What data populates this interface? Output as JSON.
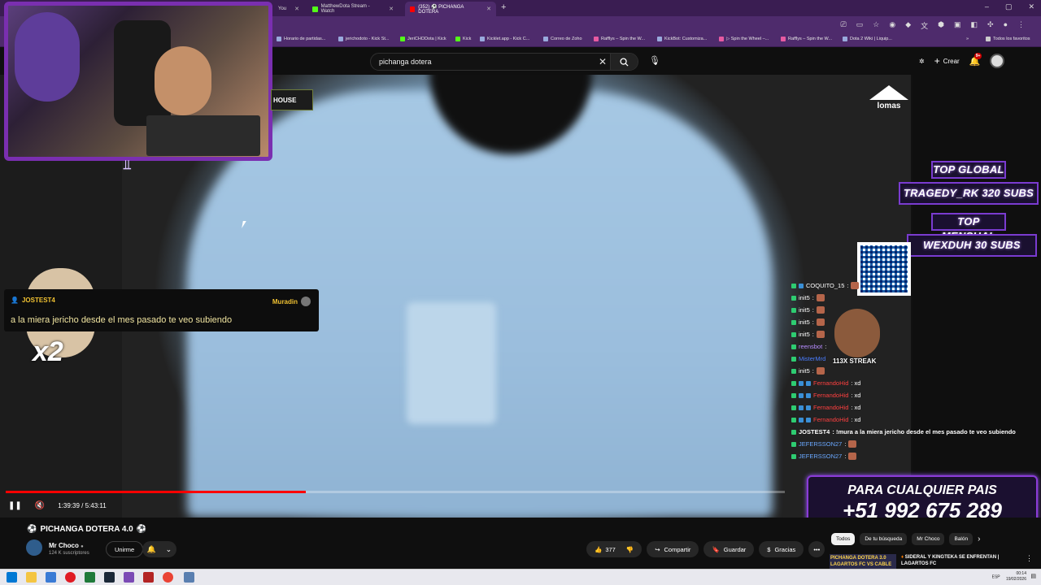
{
  "browser": {
    "tabs": [
      {
        "label": "You",
        "active": false
      },
      {
        "label": "MatthewDota Stream - Watch",
        "active": false
      },
      {
        "label": "(352) ⚽ PICHANGA DOTERA",
        "active": true
      }
    ],
    "bookmarks": [
      "Horario de partidas...",
      "jerichodoto - Kick St...",
      "JeriCHODota | Kick",
      "Kick",
      "Kicklet.app - Kick C...",
      "Correo de Zoho",
      "Rafflys – Spin the W...",
      "KickBot: Customiza...",
      "▷ Spin the Wheel –...",
      "Rafflys – Spin the W...",
      "Dota 2 Wiki | Liquip...",
      "Todos los favoritos"
    ]
  },
  "youtube": {
    "search_value": "pichanga dotera",
    "create_label": "Crear",
    "notif_count": "9+"
  },
  "overlay": {
    "house_text": "HOUSE",
    "lomas_text": "lomas",
    "x2_text": "x2",
    "top_global_title": "TOP GLOBAL",
    "top_global_value": "TRAGEDY_RK 320 SUBS",
    "top_mensual_title": "TOP MENSUAL",
    "top_mensual_value": "WEXDUH 30 SUBS",
    "streak_text": "113X STREAK",
    "promo_line1": "PARA CUALQUIER PAIS",
    "promo_line2": "+51 992 675 289"
  },
  "chat_popup": {
    "user": "JOSTEST4",
    "badge": "Muradin",
    "message": "a la miera jericho desde el mes pasado te veo subiendo"
  },
  "chat": [
    {
      "name": "COQUITO_15",
      "text": ":",
      "color": "#ffffff"
    },
    {
      "name": "init5",
      "text": ":",
      "color": "#ffffff"
    },
    {
      "name": "init5",
      "text": ":",
      "color": "#ffffff"
    },
    {
      "name": "init5",
      "text": ":",
      "color": "#ffffff"
    },
    {
      "name": "init5",
      "text": ":",
      "color": "#ffffff"
    },
    {
      "name": "reensbot",
      "text": ":",
      "color": "#b78cff"
    },
    {
      "name": "MisterMrd",
      "text": "",
      "color": "#4a7dff"
    },
    {
      "name": "init5",
      "text": ":",
      "color": "#ffffff"
    },
    {
      "name": "FernandoHid",
      "text": ": xd",
      "color": "#ff4040"
    },
    {
      "name": "FernandoHid",
      "text": ": xd",
      "color": "#ff4040"
    },
    {
      "name": "FernandoHid",
      "text": ": xd",
      "color": "#ff4040"
    },
    {
      "name": "FernandoHid",
      "text": ": xd",
      "color": "#ff4040"
    },
    {
      "name": "JOSTEST4",
      "text": ": !mura a la miera jericho desde el mes pasado te veo subiendo",
      "color": "#ffffff"
    },
    {
      "name": "JEFERSSON27",
      "text": ":",
      "color": "#6aa8ff"
    },
    {
      "name": "JEFERSSON27",
      "text": ":",
      "color": "#6aa8ff"
    }
  ],
  "player": {
    "time": "1:39:39 / 5:43:11",
    "progress": 0.385
  },
  "video": {
    "title": "PICHANGA DOTERA 4.0",
    "channel": "Mr Choco",
    "subscribers": "124 K suscriptores",
    "join_label": "Unirme",
    "likes": "377",
    "share_label": "Compartir",
    "save_label": "Guardar",
    "thanks_label": "Gracias"
  },
  "filters": [
    "Todos",
    "De tu búsqueda",
    "Mr Choco",
    "Balón"
  ],
  "recommended": {
    "thumb_text": "PICHANGA DOTERA 3.0 LAGARTOS FC VS CABLE PELAO FC",
    "title": "SIDERAL Y KINGTEKA SE ENFRENTAN | LAGARTOS FC"
  },
  "taskbar": {
    "time": "00:14",
    "date": "19/02/2026",
    "lang": "ESP"
  }
}
